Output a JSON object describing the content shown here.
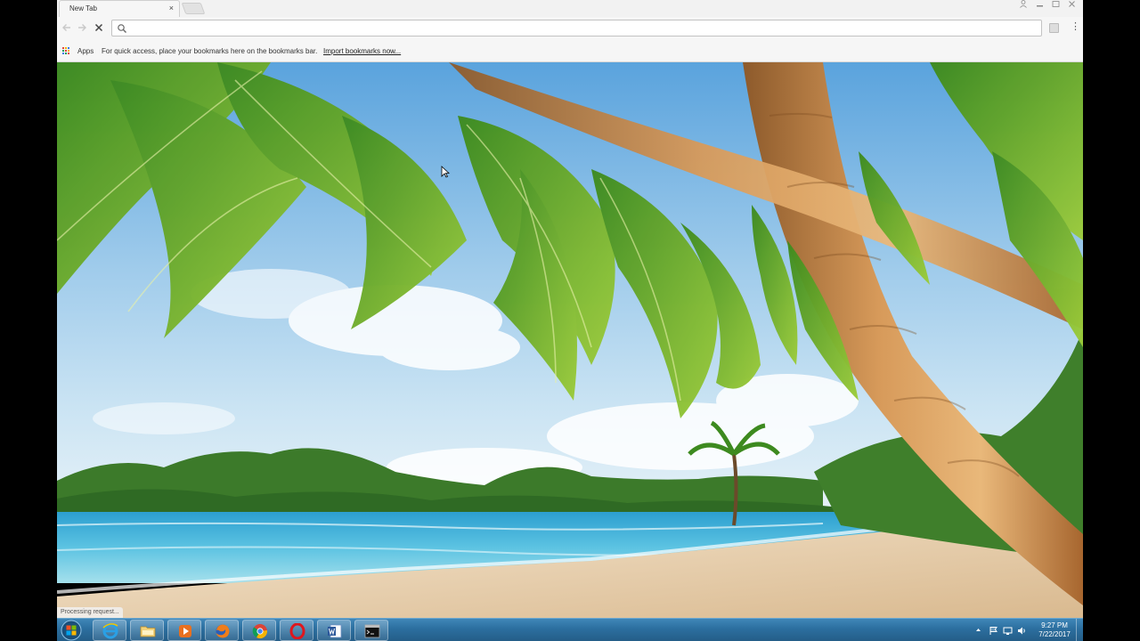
{
  "browser": {
    "tab_title": "New Tab",
    "tab_close": "×",
    "omnibox": {
      "value": "",
      "placeholder": ""
    },
    "bookmarks": {
      "apps_label": "Apps",
      "hint": "For quick access, place your bookmarks here on the bookmarks bar.",
      "import_link": "Import bookmarks now..."
    },
    "status_text": "Processing request..."
  },
  "taskbar": {
    "apps": [
      {
        "name": "Internet Explorer",
        "icon": "ie-icon"
      },
      {
        "name": "Windows Explorer",
        "icon": "folder-icon"
      },
      {
        "name": "Media Player",
        "icon": "media-player-icon"
      },
      {
        "name": "Firefox",
        "icon": "firefox-icon"
      },
      {
        "name": "Chrome",
        "icon": "chrome-icon"
      },
      {
        "name": "Opera",
        "icon": "opera-icon"
      },
      {
        "name": "Word",
        "icon": "word-icon"
      },
      {
        "name": "Command Prompt",
        "icon": "cmd-icon"
      }
    ],
    "clock": {
      "time": "9:27 PM",
      "date": "7/22/2017"
    }
  },
  "colors": {
    "taskbar": "#2c6f9f",
    "chrome_bar": "#f6f6f6",
    "sky": "#8fc6ea",
    "sea": "#4fb8dc",
    "sand": "#efd8b6"
  }
}
